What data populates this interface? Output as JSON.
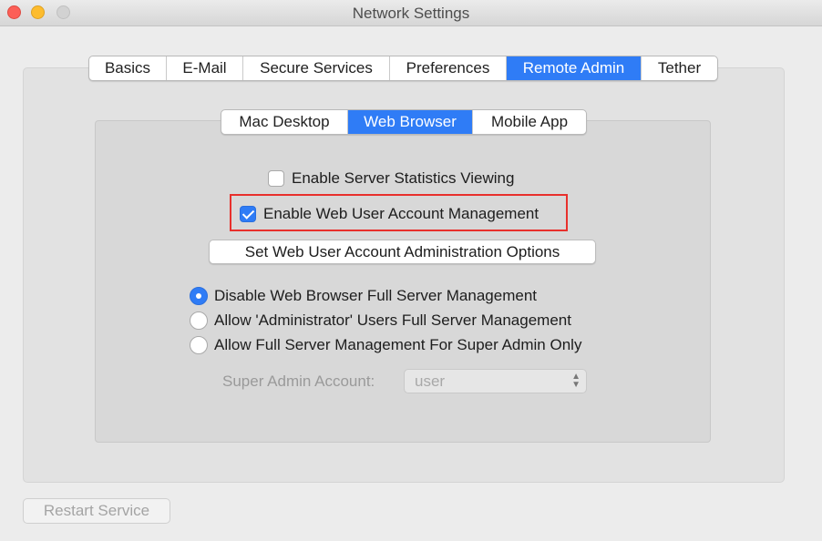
{
  "window": {
    "title": "Network Settings"
  },
  "tabs": [
    {
      "label": "Basics",
      "active": false
    },
    {
      "label": "E-Mail",
      "active": false
    },
    {
      "label": "Secure Services",
      "active": false
    },
    {
      "label": "Preferences",
      "active": false
    },
    {
      "label": "Remote Admin",
      "active": true
    },
    {
      "label": "Tether",
      "active": false
    }
  ],
  "subtabs": [
    {
      "label": "Mac Desktop",
      "active": false
    },
    {
      "label": "Web Browser",
      "active": true
    },
    {
      "label": "Mobile App",
      "active": false
    }
  ],
  "options": {
    "stats_label": "Enable Server Statistics Viewing",
    "stats_checked": false,
    "web_user_label": "Enable Web User Account Management",
    "web_user_checked": true,
    "set_options_button": "Set Web User Account Administration Options"
  },
  "radios": [
    {
      "label": "Disable Web Browser Full Server Management",
      "selected": true
    },
    {
      "label": "Allow 'Administrator' Users Full Server Management",
      "selected": false
    },
    {
      "label": "Allow Full Server Management For Super Admin Only",
      "selected": false
    }
  ],
  "super_admin": {
    "label": "Super Admin Account:",
    "value": "user"
  },
  "footer": {
    "restart_label": "Restart Service"
  },
  "colors": {
    "accent": "#2f7cf6",
    "highlight": "#e8302c"
  }
}
